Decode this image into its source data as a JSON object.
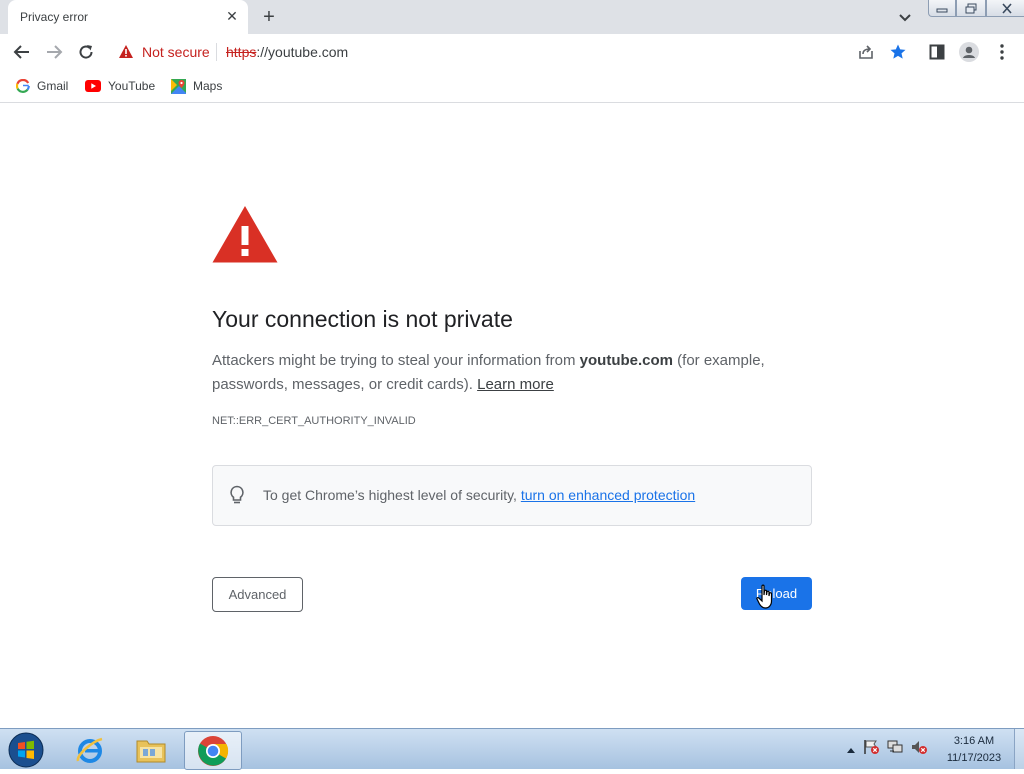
{
  "tab": {
    "title": "Privacy error"
  },
  "toolbar": {
    "security_label": "Not secure",
    "url_scheme": "https",
    "url_rest": "://youtube.com"
  },
  "bookmarks": [
    {
      "label": "Gmail"
    },
    {
      "label": "YouTube"
    },
    {
      "label": "Maps"
    }
  ],
  "page": {
    "heading": "Your connection is not private",
    "desc_prefix": "Attackers might be trying to steal your information from",
    "desc_host": "youtube.com",
    "desc_suffix": "(for example, passwords, messages, or credit cards).",
    "learn_more": "Learn more",
    "error_code": "NET::ERR_CERT_AUTHORITY_INVALID",
    "promo_text": "To get Chrome’s highest level of security,",
    "promo_link": "turn on enhanced protection",
    "advanced_button": "Advanced",
    "reload_button": "Reload"
  },
  "taskbar": {
    "time": "3:16 AM",
    "date": "11/17/2023"
  },
  "colors": {
    "accent": "#1a73e8",
    "danger": "#d93025",
    "not_secure": "#c5221f"
  }
}
